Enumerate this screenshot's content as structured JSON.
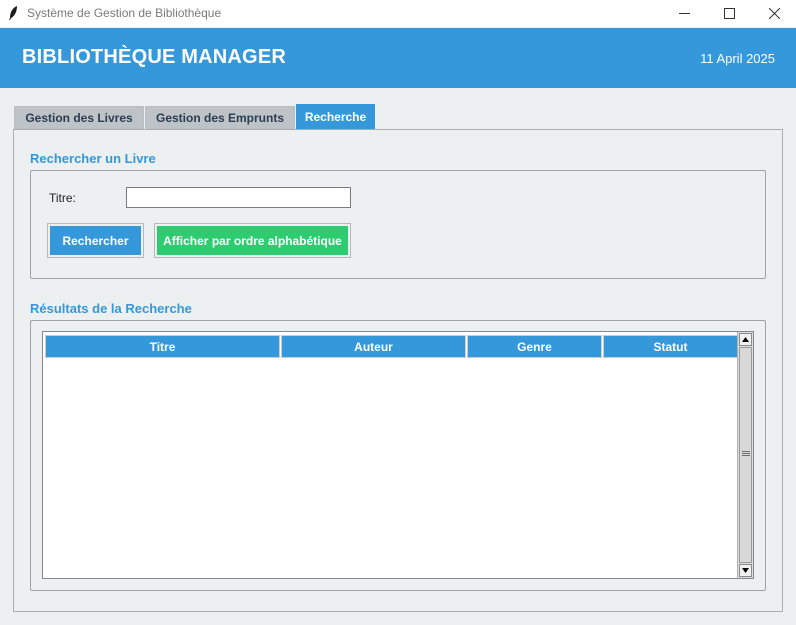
{
  "window": {
    "title": "Système de Gestion de Bibliothèque",
    "controls": [
      "minimize-icon",
      "maximize-icon",
      "close-icon"
    ]
  },
  "header": {
    "title": "BIBLIOTHÈQUE MANAGER",
    "date": "11 April 2025"
  },
  "tabs": [
    {
      "label": "Gestion des Livres",
      "active": false
    },
    {
      "label": "Gestion des Emprunts",
      "active": false
    },
    {
      "label": "Recherche",
      "active": true
    }
  ],
  "search": {
    "section_title": "Rechercher un Livre",
    "title_label": "Titre:",
    "title_value": "",
    "search_button": "Rechercher",
    "alpha_button": "Afficher par ordre alphabétique"
  },
  "results": {
    "section_title": "Résultats de la Recherche",
    "columns": [
      "Titre",
      "Auteur",
      "Genre",
      "Statut"
    ],
    "rows": []
  },
  "colors": {
    "accent": "#3498db",
    "success": "#2ecc71",
    "background": "#ecf0f1",
    "tab_inactive": "#bdc3c7",
    "text_dark": "#2c3e50"
  }
}
